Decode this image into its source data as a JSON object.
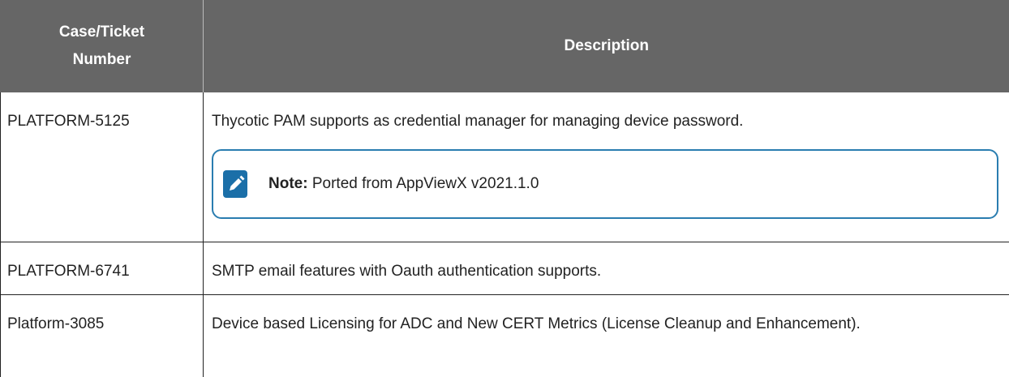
{
  "table": {
    "headers": {
      "case": "Case/Ticket Number",
      "description": "Description"
    },
    "rows": [
      {
        "case": "PLATFORM-5125",
        "description": "Thycotic PAM supports as credential manager for managing device password.",
        "note": {
          "label": "Note:",
          "text": "Ported from AppViewX v2021.1.0",
          "icon": "edit-note-icon"
        }
      },
      {
        "case": "PLATFORM-6741",
        "description": "SMTP email features with Oauth authentication supports."
      },
      {
        "case": "Platform-3085",
        "description": "Device based Licensing for ADC and New CERT Metrics (License Cleanup and Enhancement)."
      }
    ]
  },
  "colors": {
    "header_bg": "#666666",
    "note_border": "#2a7db0",
    "note_icon": "#1b6fa8"
  }
}
